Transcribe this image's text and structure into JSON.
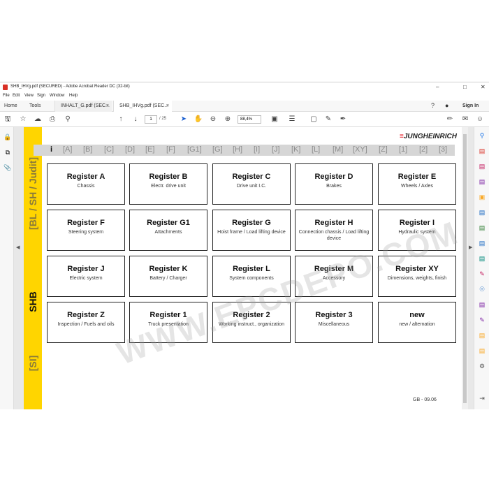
{
  "window": {
    "title": "SHB_IHVg.pdf (SECURED) - Adobe Acrobat Reader DC (32-bit)",
    "controls": [
      "–",
      "□",
      "✕"
    ]
  },
  "menu": [
    "File",
    "Edit",
    "View",
    "Sign",
    "Window",
    "Help"
  ],
  "tabs": {
    "home": "Home",
    "tools": "Tools",
    "docs": [
      {
        "label": "INHALT_G.pdf (SEC...",
        "close": "×"
      },
      {
        "label": "SHB_IHVg.pdf (SEC...",
        "close": "×"
      }
    ],
    "sign_in": "Sign In"
  },
  "toolbar": {
    "page_current": "1",
    "page_total": "/ 25",
    "zoom": "88,4%"
  },
  "sidebar_labels": {
    "top": "[BL / SH / Judit]",
    "middle": "SHB",
    "bottom": "[SI]"
  },
  "logo": {
    "mark": "≡",
    "text": "JUNGHEINRICH"
  },
  "register_bar": [
    "i",
    "[A]",
    "[B]",
    "[C]",
    "[D]",
    "[E]",
    "[F]",
    "[G1]",
    "[G]",
    "[H]",
    "[I]",
    "[J]",
    "[K]",
    "[L]",
    "[M]",
    "[XY]",
    "[Z]",
    "[1]",
    "[2]",
    "[3]"
  ],
  "cards": [
    {
      "title": "Register A",
      "subtitle": "Chassis"
    },
    {
      "title": "Register B",
      "subtitle": "Electr. drive unit"
    },
    {
      "title": "Register C",
      "subtitle": "Drive unit I.C."
    },
    {
      "title": "Register D",
      "subtitle": "Brakes"
    },
    {
      "title": "Register E",
      "subtitle": "Wheels / Axles"
    },
    {
      "title": "Register F",
      "subtitle": "Steering system"
    },
    {
      "title": "Register G1",
      "subtitle": "Attachments"
    },
    {
      "title": "Register G",
      "subtitle": "Hoist frame / Load lifting device"
    },
    {
      "title": "Register H",
      "subtitle": "Connection chassis / Load lifting device"
    },
    {
      "title": "Register I",
      "subtitle": "Hydraulic system"
    },
    {
      "title": "Register J",
      "subtitle": "Electric system"
    },
    {
      "title": "Register K",
      "subtitle": "Battery / Charger"
    },
    {
      "title": "Register L",
      "subtitle": "System components"
    },
    {
      "title": "Register M",
      "subtitle": "Accessory"
    },
    {
      "title": "Register XY",
      "subtitle": "Dimensions, weights, finish"
    },
    {
      "title": "Register Z",
      "subtitle": "Inspection / Fuels and oils"
    },
    {
      "title": "Register 1",
      "subtitle": "Truck presentation"
    },
    {
      "title": "Register 2",
      "subtitle": "Working instruct., organization"
    },
    {
      "title": "Register 3",
      "subtitle": "Miscellaneous"
    },
    {
      "title": "new",
      "subtitle": "new / alternation"
    }
  ],
  "footer": "GB - 09.06",
  "watermark": "WWW.EPCDEPO.COM",
  "colors": {
    "accent_yellow": "#ffd500",
    "logo_red": "#e30613",
    "register_bar": "#d6d6d6"
  }
}
